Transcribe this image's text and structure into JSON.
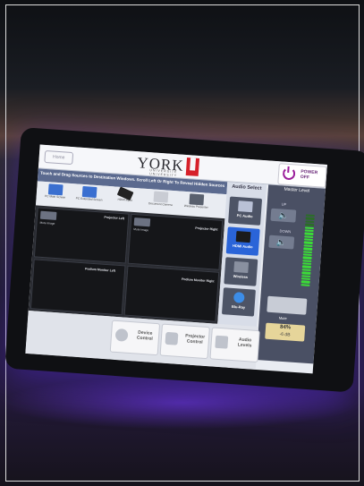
{
  "header": {
    "home_label": "Home",
    "logo_word": "YORK",
    "logo_sub": "UNIVERSITÉ UNIVERSITY",
    "power_label": "POWER OFF"
  },
  "instruction": "Touch and Drag Sources to Destination Windows. Scroll Left Or Right To Reveal Hidden Sources",
  "sources": [
    {
      "label": "PC Main Screen",
      "icon": "desktop-icon"
    },
    {
      "label": "PC Extended Screen",
      "icon": "desktop-icon"
    },
    {
      "label": "HDMI Input",
      "icon": "hdmi-cable-icon"
    },
    {
      "label": "Document Camera",
      "icon": "document-camera-icon"
    },
    {
      "label": "Wireless Presenter",
      "icon": "wireless-presenter-icon"
    }
  ],
  "windows": {
    "projector_left": {
      "label": "Projector Left",
      "action": "Mute Image"
    },
    "projector_right": {
      "label": "Projector Right",
      "action": "Mute Image"
    },
    "podium_left": {
      "label": "Podium Monitor Left"
    },
    "podium_right": {
      "label": "Podium Monitor Right"
    }
  },
  "audio_select": {
    "title": "Audio Select",
    "items": [
      {
        "label": "PC Audio",
        "active": false
      },
      {
        "label": "HDMI Audio",
        "active": true
      },
      {
        "label": "Wireless",
        "active": false
      },
      {
        "label": "Blu-Ray",
        "active": false
      }
    ]
  },
  "master": {
    "title": "Master Level",
    "up_label": "UP",
    "down_label": "DOWN",
    "mute_label": "Mute",
    "level_percent": "84%",
    "level_db": "-6 dB",
    "level_fraction": 0.84
  },
  "bottom": {
    "device_control": "Device Control",
    "projector_control": "Projector Control",
    "audio_levels": "Audio Levels"
  },
  "colors": {
    "accent_purple": "#9b1f9b",
    "brand_red": "#d6202a",
    "active_blue": "#2a64d8",
    "meter_green": "#3bdc37"
  }
}
